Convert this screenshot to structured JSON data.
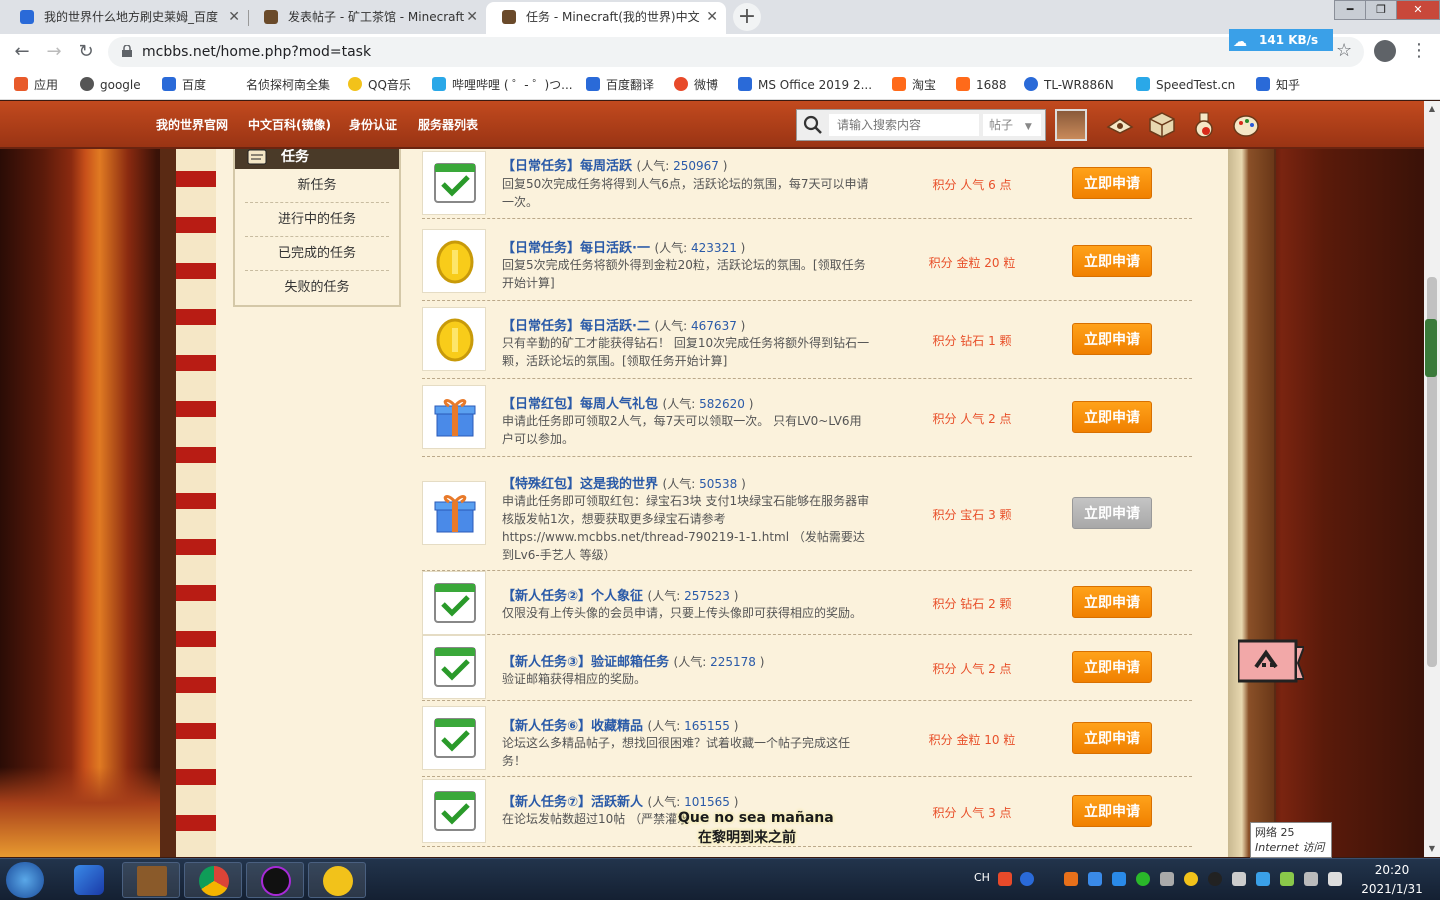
{
  "browser": {
    "tabs": [
      {
        "title": "我的世界什么地方刷史莱姆_百度",
        "color": "#2a6ad8"
      },
      {
        "title": "发表帖子 - 矿工茶馆 - Minecraft",
        "color": "#6a4a2a"
      },
      {
        "title": "任务 - Minecraft(我的世界)中文",
        "color": "#6a4a2a"
      }
    ],
    "url": "mcbbs.net/home.php?mod=task",
    "speed": "141 KB/s",
    "bookmarks": [
      {
        "label": "应用",
        "color": "#e85a2a"
      },
      {
        "label": "google",
        "color": "#555555"
      },
      {
        "label": "百度",
        "color": "#2a6ad8"
      },
      {
        "label": "名侦探柯南全集",
        "color": "#ffffff"
      },
      {
        "label": "QQ音乐",
        "color": "#f2c21a"
      },
      {
        "label": "哔哩哔哩 ( ゜- ゜)つ...",
        "color": "#2aa8e8"
      },
      {
        "label": "百度翻译",
        "color": "#2a6ad8"
      },
      {
        "label": "微博",
        "color": "#e84a2a"
      },
      {
        "label": "MS Office 2019 2...",
        "color": "#2a6ad8"
      },
      {
        "label": "淘宝",
        "color": "#ff6a1a"
      },
      {
        "label": "1688",
        "color": "#ff6a1a"
      },
      {
        "label": "TL-WR886N",
        "color": "#2a6ad8"
      },
      {
        "label": "SpeedTest.cn",
        "color": "#2aa8e8"
      },
      {
        "label": "知乎",
        "color": "#2a6ad8"
      }
    ]
  },
  "site": {
    "nav": [
      "我的世界官网",
      "中文百科(镜像)",
      "身份认证",
      "服务器列表"
    ],
    "search_placeholder": "请输入搜索内容",
    "search_type": "帖子"
  },
  "sidebar": {
    "title": "任务",
    "items": [
      "新任务",
      "进行中的任务",
      "已完成的任务",
      "失败的任务"
    ]
  },
  "apply_label": "立即申请",
  "popularity_label": "人气: ",
  "tasks": [
    {
      "title": "【日常任务】每周活跃",
      "popularity": "250967",
      "desc": "回复50次完成任务将得到人气6点，活跃论坛的氛围，每7天可以申请一次。",
      "reward": "积分 人气 6 点",
      "icon": "check",
      "enabled": true
    },
    {
      "title": "【日常任务】每日活跃·一",
      "popularity": "423321",
      "desc": "回复5次完成任务将额外得到金粒20粒，活跃论坛的氛围。[领取任务开始计算]",
      "reward": "积分 金粒 20 粒",
      "icon": "coin",
      "enabled": true
    },
    {
      "title": "【日常任务】每日活跃·二",
      "popularity": "467637",
      "desc": "只有辛勤的矿工才能获得钻石！ 回复10次完成任务将额外得到钻石一颗，活跃论坛的氛围。[领取任务开始计算]",
      "reward": "积分 钻石 1 颗",
      "icon": "coin",
      "enabled": true
    },
    {
      "title": "【日常红包】每周人气礼包",
      "popularity": "582620",
      "desc": "申请此任务即可领取2人气，每7天可以领取一次。 只有LV0~LV6用户可以参加。",
      "reward": "积分 人气 2 点",
      "icon": "gift",
      "enabled": true
    },
    {
      "title": "【特殊红包】这是我的世界",
      "popularity": "50538",
      "desc": "申请此任务即可领取红包：绿宝石3块 支付1块绿宝石能够在服务器审核版发帖1次，想要获取更多绿宝石请参考 https://www.mcbbs.net/thread-790219-1-1.html （发帖需要达到Lv6-手艺人 等级）",
      "reward": "积分 宝石 3 颗",
      "icon": "gift",
      "enabled": false
    },
    {
      "title": "【新人任务②】个人象征",
      "popularity": "257523",
      "desc": "仅限没有上传头像的会员申请，只要上传头像即可获得相应的奖励。",
      "reward": "积分 钻石 2 颗",
      "icon": "check",
      "enabled": true
    },
    {
      "title": "【新人任务③】验证邮箱任务",
      "popularity": "225178",
      "desc": "验证邮箱获得相应的奖励。",
      "reward": "积分 人气 2 点",
      "icon": "check",
      "enabled": true
    },
    {
      "title": "【新人任务⑥】收藏精品",
      "popularity": "165155",
      "desc": "论坛这么多精品帖子，想找回很困难？试着收藏一个帖子完成这任务！",
      "reward": "积分 金粒 10 粒",
      "icon": "check",
      "enabled": true
    },
    {
      "title": "【新人任务⑦】活跃新人",
      "popularity": "101565",
      "desc": "在论坛发帖数超过10帖 （严禁灌水",
      "reward": "积分 人气 3 点",
      "icon": "check",
      "enabled": true
    }
  ],
  "subtitles": {
    "line1": "Que no sea mañana",
    "line2": "在黎明到来之前"
  },
  "tooltip": {
    "line1": "网络  25",
    "line2": "Internet 访问"
  },
  "taskbar": {
    "lang": "CH",
    "time": "20:20",
    "date": "2021/1/31"
  }
}
